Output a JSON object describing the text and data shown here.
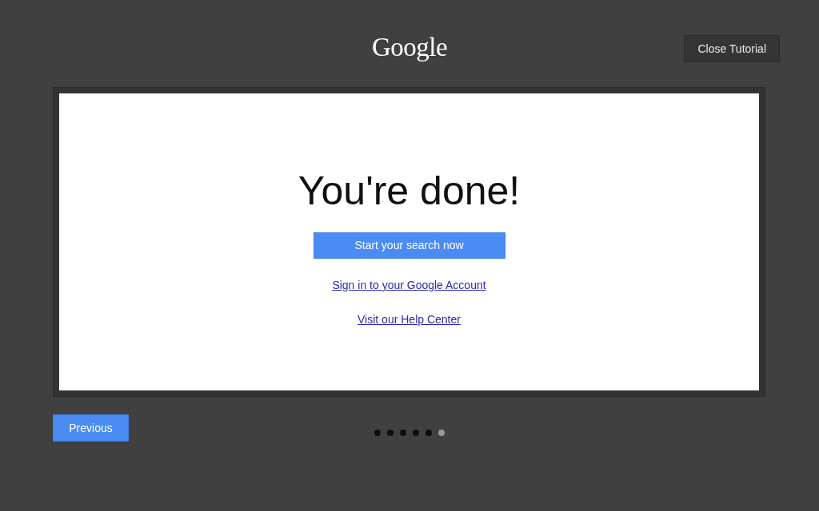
{
  "header": {
    "logo": "Google",
    "close_button": "Close Tutorial"
  },
  "slide": {
    "heading": "You're done!",
    "primary_button": "Start your search now",
    "links": [
      "Sign in to your Google Account",
      "Visit our Help Center"
    ]
  },
  "footer": {
    "previous_button": "Previous",
    "pages": [
      {
        "selected": false
      },
      {
        "selected": false
      },
      {
        "selected": false
      },
      {
        "selected": false
      },
      {
        "selected": false
      },
      {
        "selected": true
      }
    ]
  }
}
